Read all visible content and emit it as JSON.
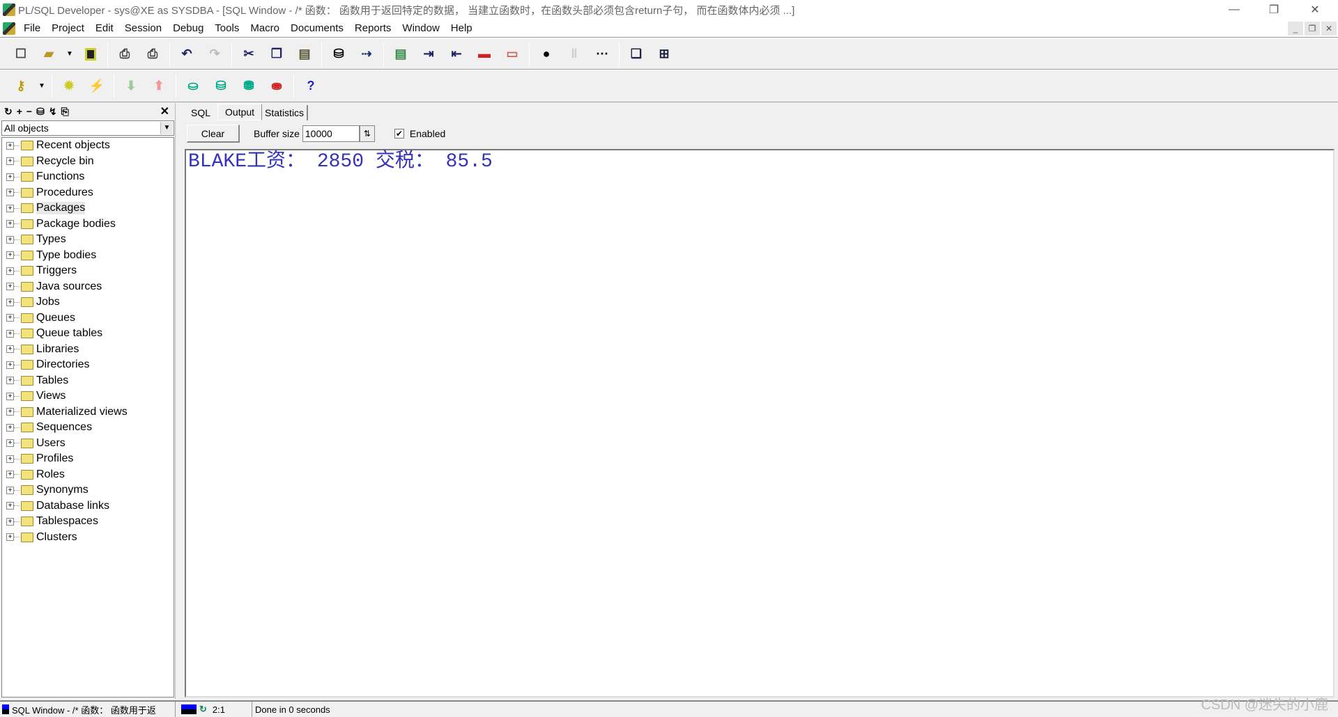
{
  "window": {
    "title": "PL/SQL Developer - sys@XE as SYSDBA - [SQL Window - /* 函数： 函数用于返回特定的数据， 当建立函数时，在函数头部必须包含return子句， 而在函数体内必须 ...]",
    "minimize": "—",
    "restore": "❐",
    "close": "✕"
  },
  "menu": [
    "File",
    "Project",
    "Edit",
    "Session",
    "Debug",
    "Tools",
    "Macro",
    "Documents",
    "Reports",
    "Window",
    "Help"
  ],
  "mdi": {
    "minimize": "_",
    "restore": "❐",
    "close": "✕"
  },
  "toolbar1": [
    "new-icon",
    "open-icon",
    "save-icon",
    "print-icon",
    "print-setup-icon",
    "undo-icon",
    "redo-icon",
    "cut-icon",
    "copy-icon",
    "paste-icon",
    "find-icon",
    "find-next-icon"
  ],
  "left_panel": {
    "close": "✕",
    "filter": "All objects",
    "items": [
      "Recent objects",
      "Recycle bin",
      "Functions",
      "Procedures",
      "Packages",
      "Package bodies",
      "Types",
      "Type bodies",
      "Triggers",
      "Java sources",
      "Jobs",
      "Queues",
      "Queue tables",
      "Libraries",
      "Directories",
      "Tables",
      "Views",
      "Materialized views",
      "Sequences",
      "Users",
      "Profiles",
      "Roles",
      "Synonyms",
      "Database links",
      "Tablespaces",
      "Clusters"
    ],
    "selected": "Packages"
  },
  "tabs": [
    {
      "label": "SQL"
    },
    {
      "label": "Output",
      "active": true
    },
    {
      "label": "Statistics"
    }
  ],
  "output_controls": {
    "clear": "Clear",
    "buffer_label": "Buffer size",
    "buffer_value": "10000",
    "enabled_label": "Enabled",
    "enabled": true
  },
  "output": {
    "lines": [
      "BLAKE工资： 2850 交税： 85.5"
    ],
    "text_color": "#3333bb"
  },
  "statusbar": {
    "window": "SQL Window - /* 函数： 函数用于返",
    "position": "2:1",
    "message": "Done in 0 seconds"
  },
  "watermark": "CSDN @迷失的小鹿"
}
